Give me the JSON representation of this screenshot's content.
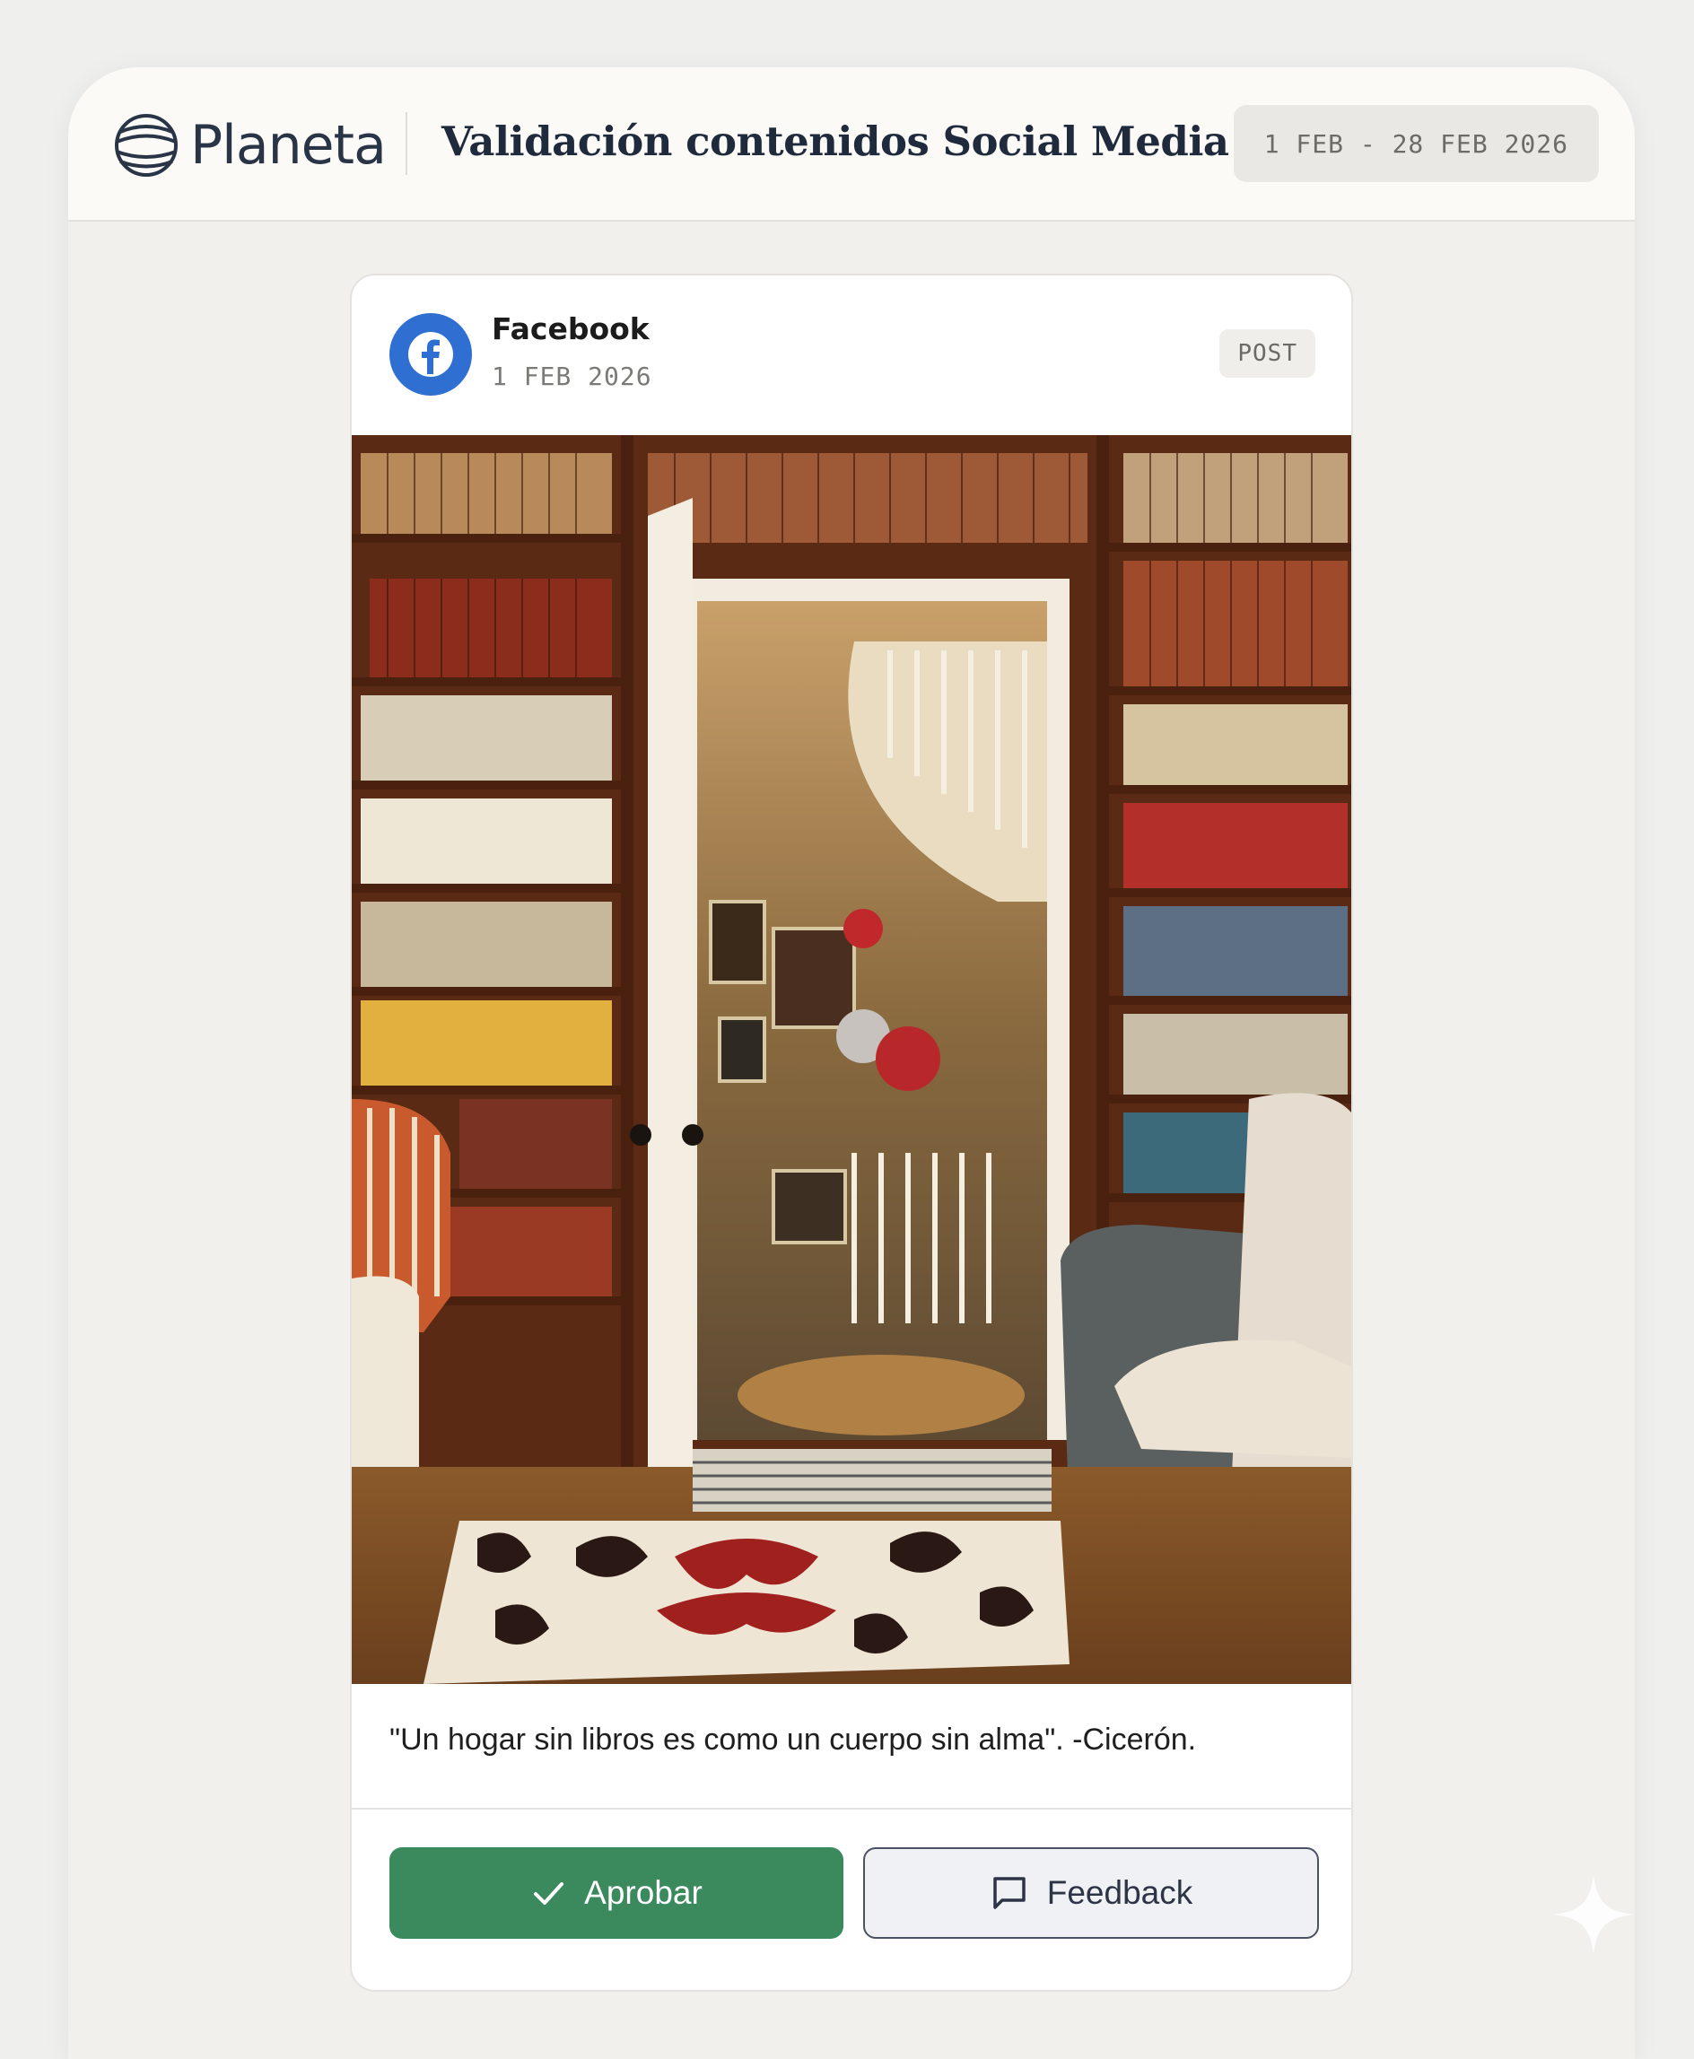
{
  "brand": {
    "logo_text": "Planeta",
    "logo_icon": "globe-icon"
  },
  "header": {
    "title": "Validación contenidos Social Media",
    "date_range": "1 FEB - 28 FEB 2026"
  },
  "post": {
    "platform": "Facebook",
    "platform_icon": "facebook-icon",
    "date": "1 FEB 2026",
    "type": "POST",
    "caption": "\"Un hogar sin libros es como un cuerpo sin alma\". -Cicerón.",
    "actions": {
      "approve_label": "Aprobar",
      "approve_icon": "check-icon",
      "feedback_label": "Feedback",
      "feedback_icon": "comment-icon"
    }
  },
  "colors": {
    "approve": "#3a8a5e",
    "facebook": "#2f6fd1",
    "brand_text": "#2a3447"
  }
}
